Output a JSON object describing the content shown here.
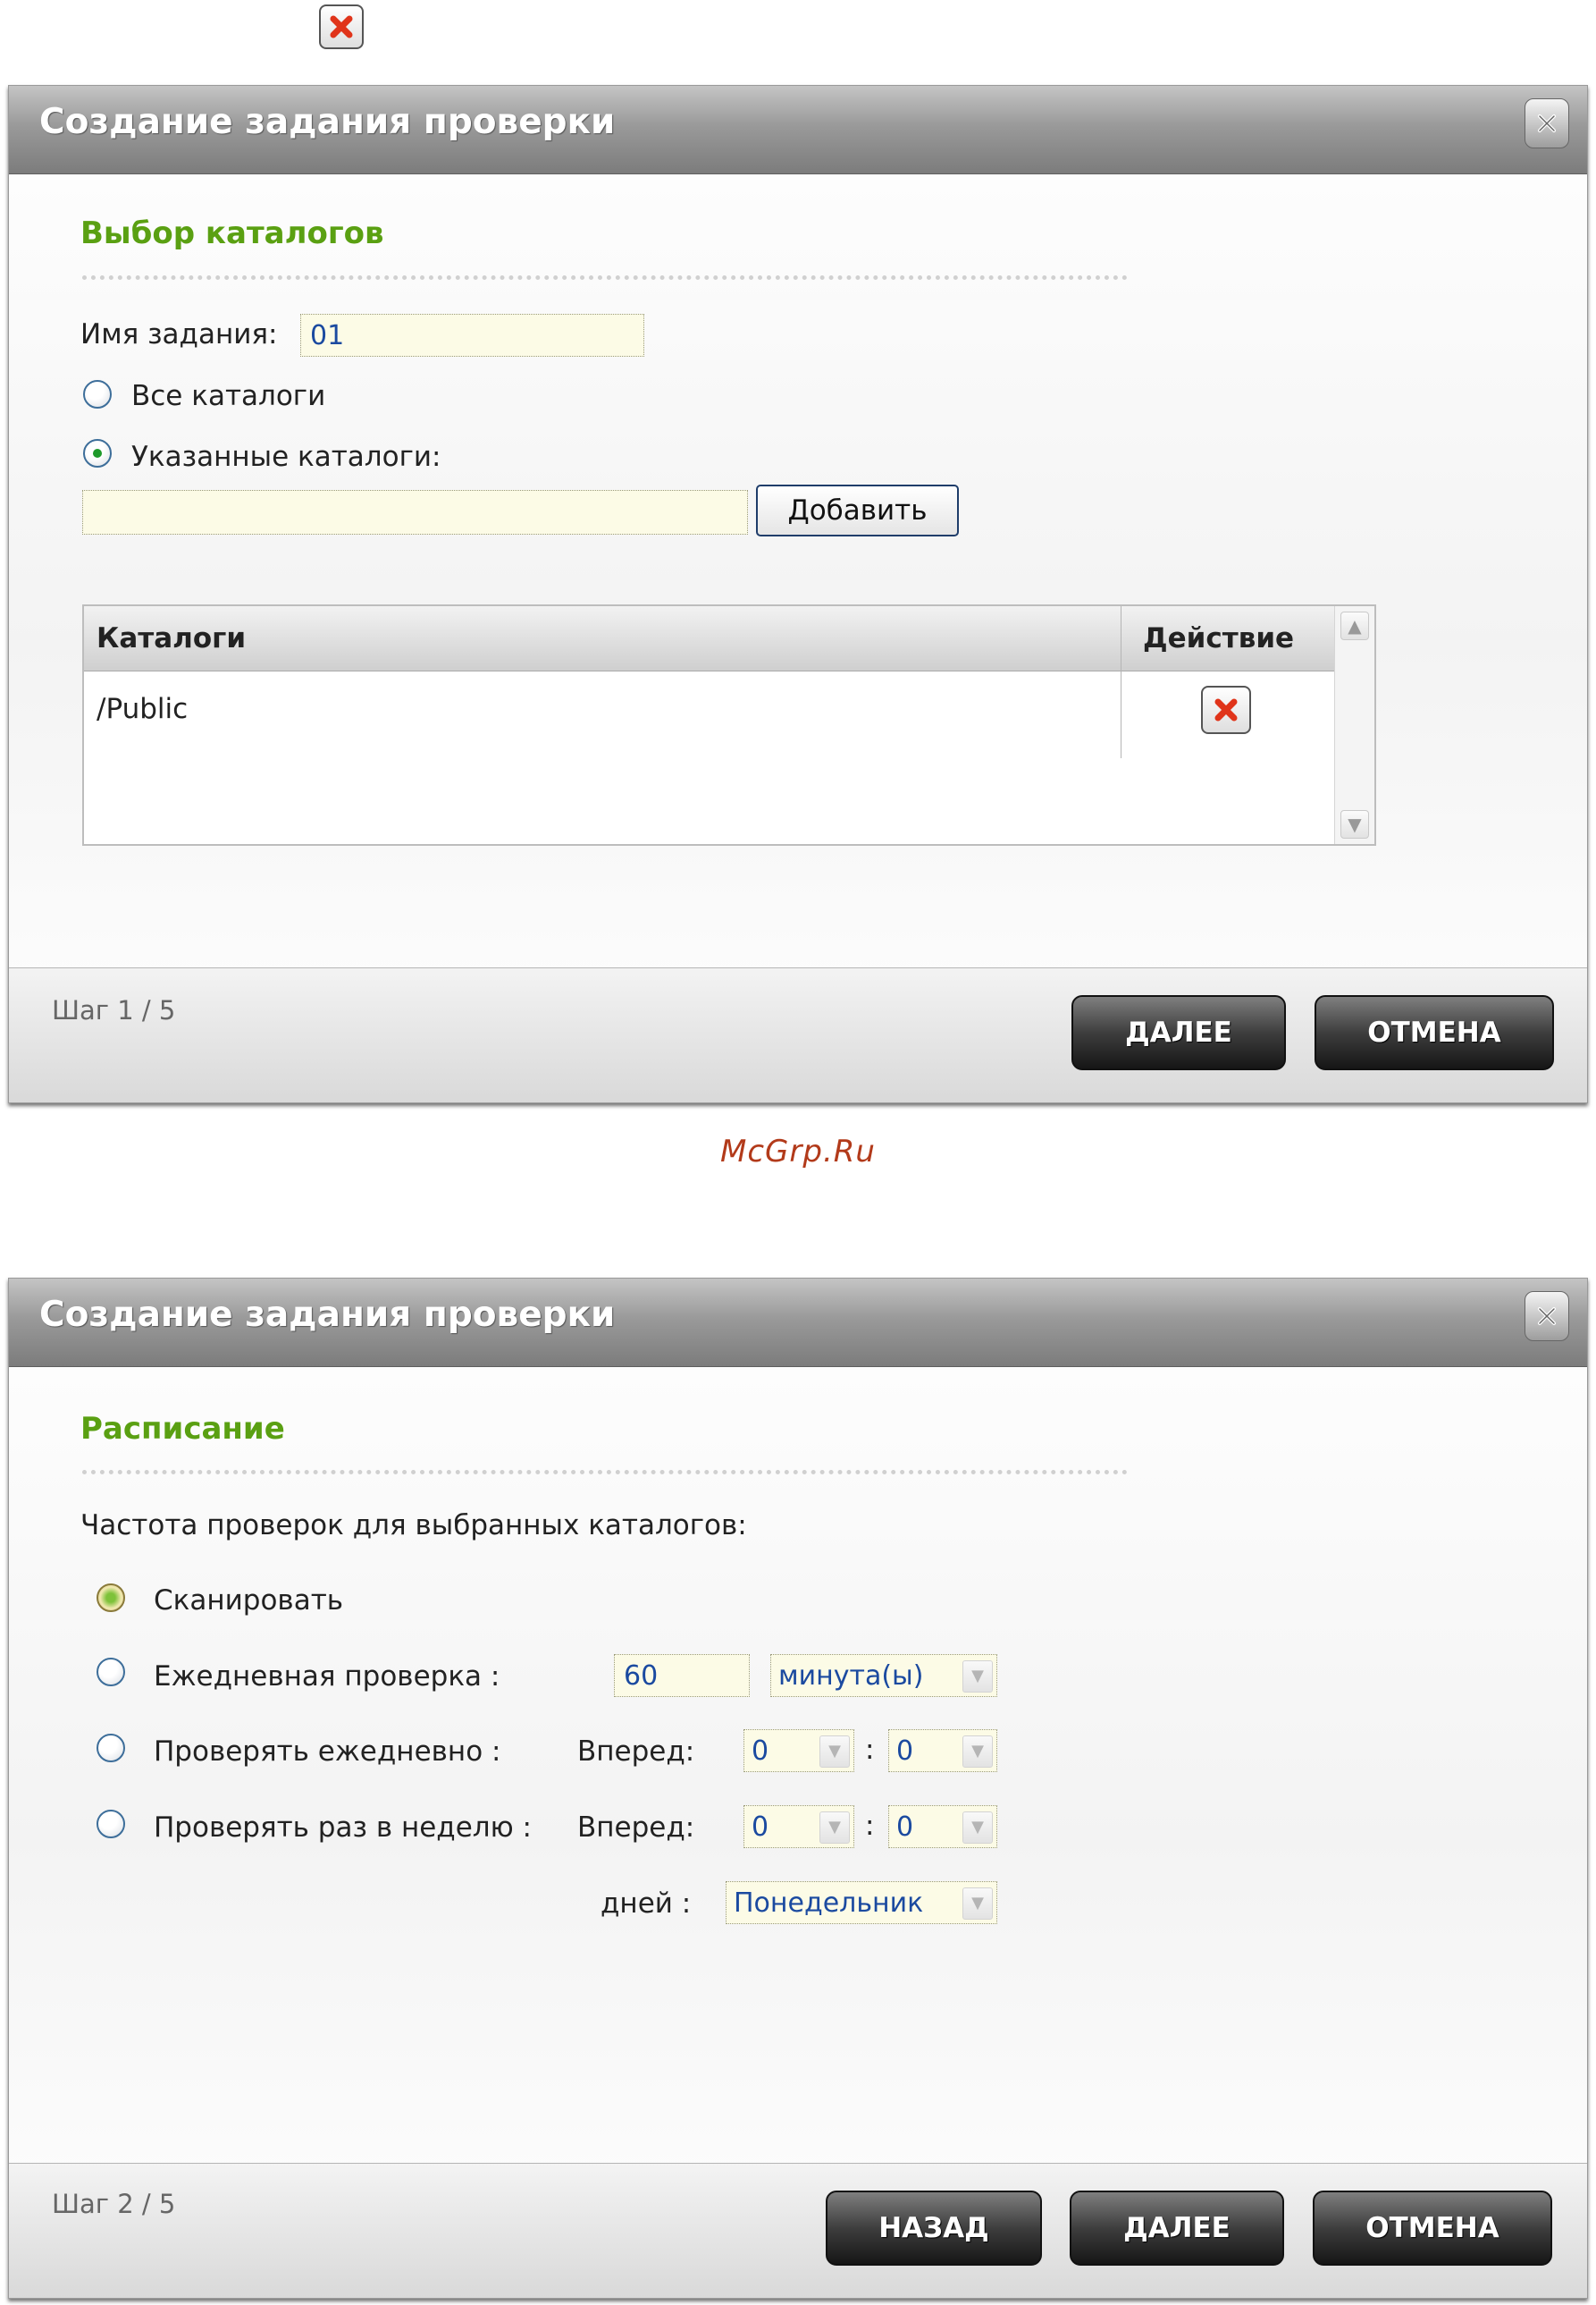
{
  "watermark": "McGrp.Ru",
  "dialog1": {
    "title": "Создание задания проверки",
    "section_title": "Выбор каталогов",
    "job_name_label": "Имя задания:",
    "job_name_value": "01",
    "option_all": "Все каталоги",
    "option_specified": "Указанные каталоги:",
    "folder_input_value": "",
    "add_button": "Добавить",
    "table": {
      "col_folders": "Каталоги",
      "col_action": "Действие",
      "rows": [
        {
          "folder": "/Public"
        }
      ]
    },
    "step": "Шаг 1 / 5",
    "next_button": "ДАЛЕЕ",
    "cancel_button": "ОТМЕНА"
  },
  "dialog2": {
    "title": "Создание задания проверки",
    "section_title": "Расписание",
    "frequency_label": "Частота проверок для выбранных каталогов:",
    "option_scan": "Сканировать",
    "option_daily_check": "Ежедневная проверка :",
    "interval_value": "60",
    "interval_unit": "минута(ы)",
    "option_check_daily": "Проверять ежедневно :",
    "option_check_weekly": "Проверять раз в неделю :",
    "ahead_label": "Вперед:",
    "colon": ":",
    "daily_hour": "0",
    "daily_minute": "0",
    "weekly_hour": "0",
    "weekly_minute": "0",
    "day_label": "дней :",
    "weekday": "Понедельник",
    "step": "Шаг 2 / 5",
    "back_button": "НАЗАД",
    "next_button": "ДАЛЕЕ",
    "cancel_button": "ОТМЕНА"
  },
  "colors": {
    "section_green": "#5aa012",
    "input_bg": "#fcfbe6",
    "value_blue": "#1b4aa0",
    "delete_red": "#e0341a"
  }
}
